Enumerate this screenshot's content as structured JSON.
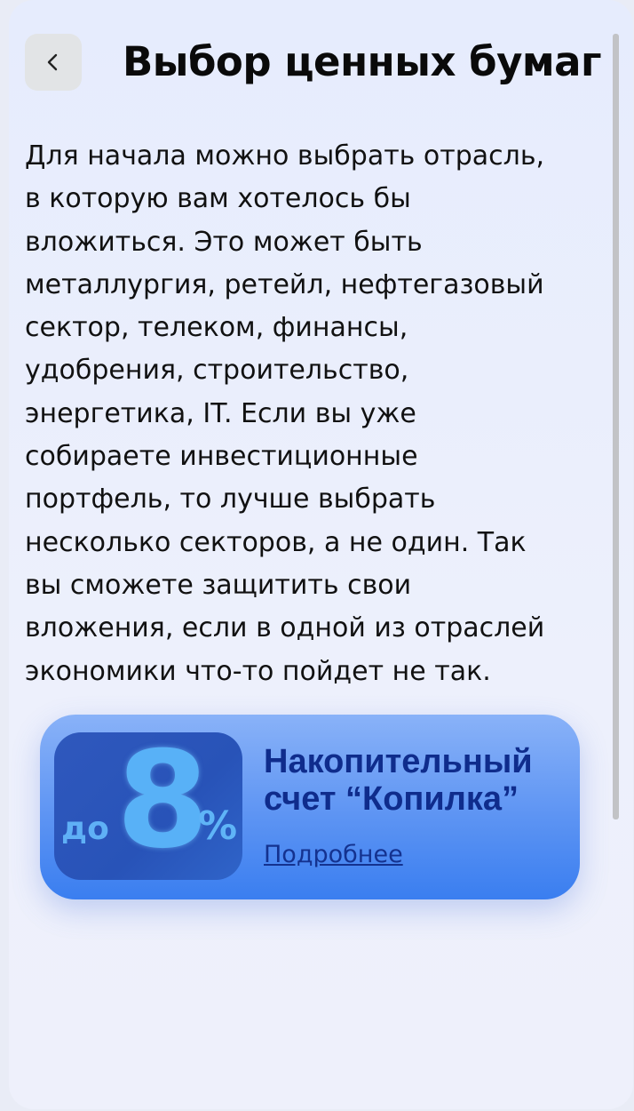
{
  "header": {
    "back_label": "<",
    "title": "Выбор ценных бумаг"
  },
  "article": {
    "text": "Для начала можно выбрать отрасль,\nв которую вам хотелось бы\nвложиться. Это может быть\nметаллургия, ретейл, нефтегазовый\nсектор, телеком, финансы,\nудобрения, строительство,\nэнергетика, IT. Если вы уже\nсобираете инвестиционные\nпортфель, то лучше выбрать\nнесколько секторов, а не один. Так\nвы сможете защитить свои\nвложения, если в одной из отраслей\nэкономики что-то пойдет не так."
  },
  "promo": {
    "badge_prefix": "до",
    "badge_number": "8",
    "badge_suffix": "%",
    "title": "Накопительный\nсчет “Копилка”",
    "link_label": "Подробнее"
  },
  "colors": {
    "background": "#e6ecfd",
    "banner_top": "#89b2f8",
    "banner_bottom": "#3a7ef0",
    "banner_title": "#0f2c8c",
    "badge_bg": "#2853b8",
    "badge_text": "#58b1f7"
  },
  "icons": {
    "back": "chevron-left-icon"
  }
}
